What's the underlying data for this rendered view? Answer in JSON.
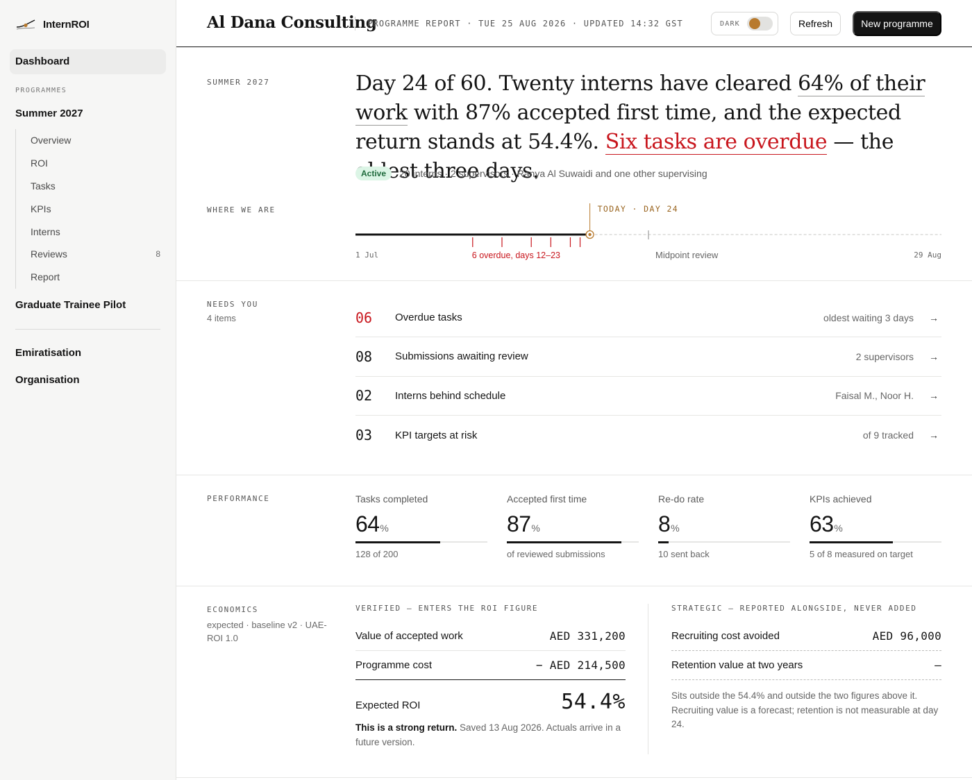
{
  "app": {
    "name": "InternROI"
  },
  "sidebar": {
    "dashboard": "Dashboard",
    "section_label": "PROGRAMMES",
    "programme": "Summer 2027",
    "subnav": [
      {
        "label": "Overview"
      },
      {
        "label": "ROI"
      },
      {
        "label": "Tasks"
      },
      {
        "label": "KPIs"
      },
      {
        "label": "Interns"
      },
      {
        "label": "Reviews",
        "count": "8"
      },
      {
        "label": "Report"
      }
    ],
    "programme_2": "Graduate Trainee Pilot",
    "links": [
      "Emiratisation",
      "Organisation"
    ]
  },
  "header": {
    "org": "Al Dana Consulting",
    "meta": "PROGRAMME REPORT · TUE 25 AUG 2026 · UPDATED 14:32 GST",
    "dark_label": "DARK",
    "dark_on": false,
    "refresh": "Refresh",
    "new_programme": "New programme"
  },
  "summary": {
    "label": "SUMMER 2027",
    "headline_a": "Day 24 of 60. Twenty interns have cleared ",
    "headline_b": "64% of their work",
    "headline_c": " with 87% accepted first time, and the expected return stands at 54.4%. ",
    "headline_d": "Six tasks are overdue",
    "headline_e": " — the oldest three days.",
    "status": "Active",
    "status_detail": "20 interns · 2 supervisors · Ranya Al Suwaidi and one other supervising"
  },
  "timeline": {
    "label": "WHERE WE ARE",
    "today": "TODAY · DAY 24",
    "start": "1 Jul",
    "end": "29 Aug",
    "overdue_note": "6 overdue, days 12–23",
    "midpoint": "Midpoint review",
    "total_days": 60,
    "current_day": 24,
    "midpoint_day": 30,
    "overdue_days": [
      12,
      15,
      18,
      20,
      22,
      23
    ]
  },
  "needs": {
    "label": "NEEDS YOU",
    "count": "4 items",
    "items": [
      {
        "num": "06",
        "label": "Overdue tasks",
        "detail": "oldest waiting 3 days",
        "alert": true
      },
      {
        "num": "08",
        "label": "Submissions awaiting review",
        "detail": "2 supervisors",
        "alert": false
      },
      {
        "num": "02",
        "label": "Interns behind schedule",
        "detail": "Faisal M., Noor H.",
        "alert": false
      },
      {
        "num": "03",
        "label": "KPI targets at risk",
        "detail": "of 9 tracked",
        "alert": false
      }
    ]
  },
  "performance": {
    "label": "PERFORMANCE",
    "kpis": [
      {
        "title": "Tasks completed",
        "value": "64",
        "unit": "%",
        "note": "128 of 200",
        "fill": 0.64
      },
      {
        "title": "Accepted first time",
        "value": "87",
        "unit": "%",
        "note": "of reviewed submissions",
        "fill": 0.87
      },
      {
        "title": "Re-do rate",
        "value": "8",
        "unit": "%",
        "note": "10 sent back",
        "fill": 0.08
      },
      {
        "title": "KPIs achieved",
        "value": "63",
        "unit": "%",
        "note": "5 of 8 measured on target",
        "fill": 0.63
      }
    ]
  },
  "economics": {
    "label": "ECONOMICS",
    "sub": "expected · baseline v2 · UAE-ROI 1.0",
    "verified_label": "VERIFIED — ENTERS THE ROI FIGURE",
    "value_label": "Value of accepted work",
    "value_amt": "AED 331,200",
    "cost_label": "Programme cost",
    "cost_amt": "− AED 214,500",
    "roi_label": "Expected ROI",
    "roi_value": "54.4%",
    "roi_note_bold": "This is a strong return.",
    "roi_note": "Saved 13 Aug 2026. Actuals arrive in a future version.",
    "strategic_label": "STRATEGIC — REPORTED ALONGSIDE, NEVER ADDED",
    "recruit_label": "Recruiting cost avoided",
    "recruit_amt": "AED 96,000",
    "retention_label": "Retention value at two years",
    "retention_amt": "—",
    "strategic_note": "Sits outside the 54.4% and outside the two figures above it. Recruiting value is a forecast; retention is not measurable at day 24."
  },
  "colors": {
    "alert": "#c8161d",
    "accent": "#b87a2e",
    "ink": "#141414",
    "active_bg": "#dcf5e6"
  }
}
